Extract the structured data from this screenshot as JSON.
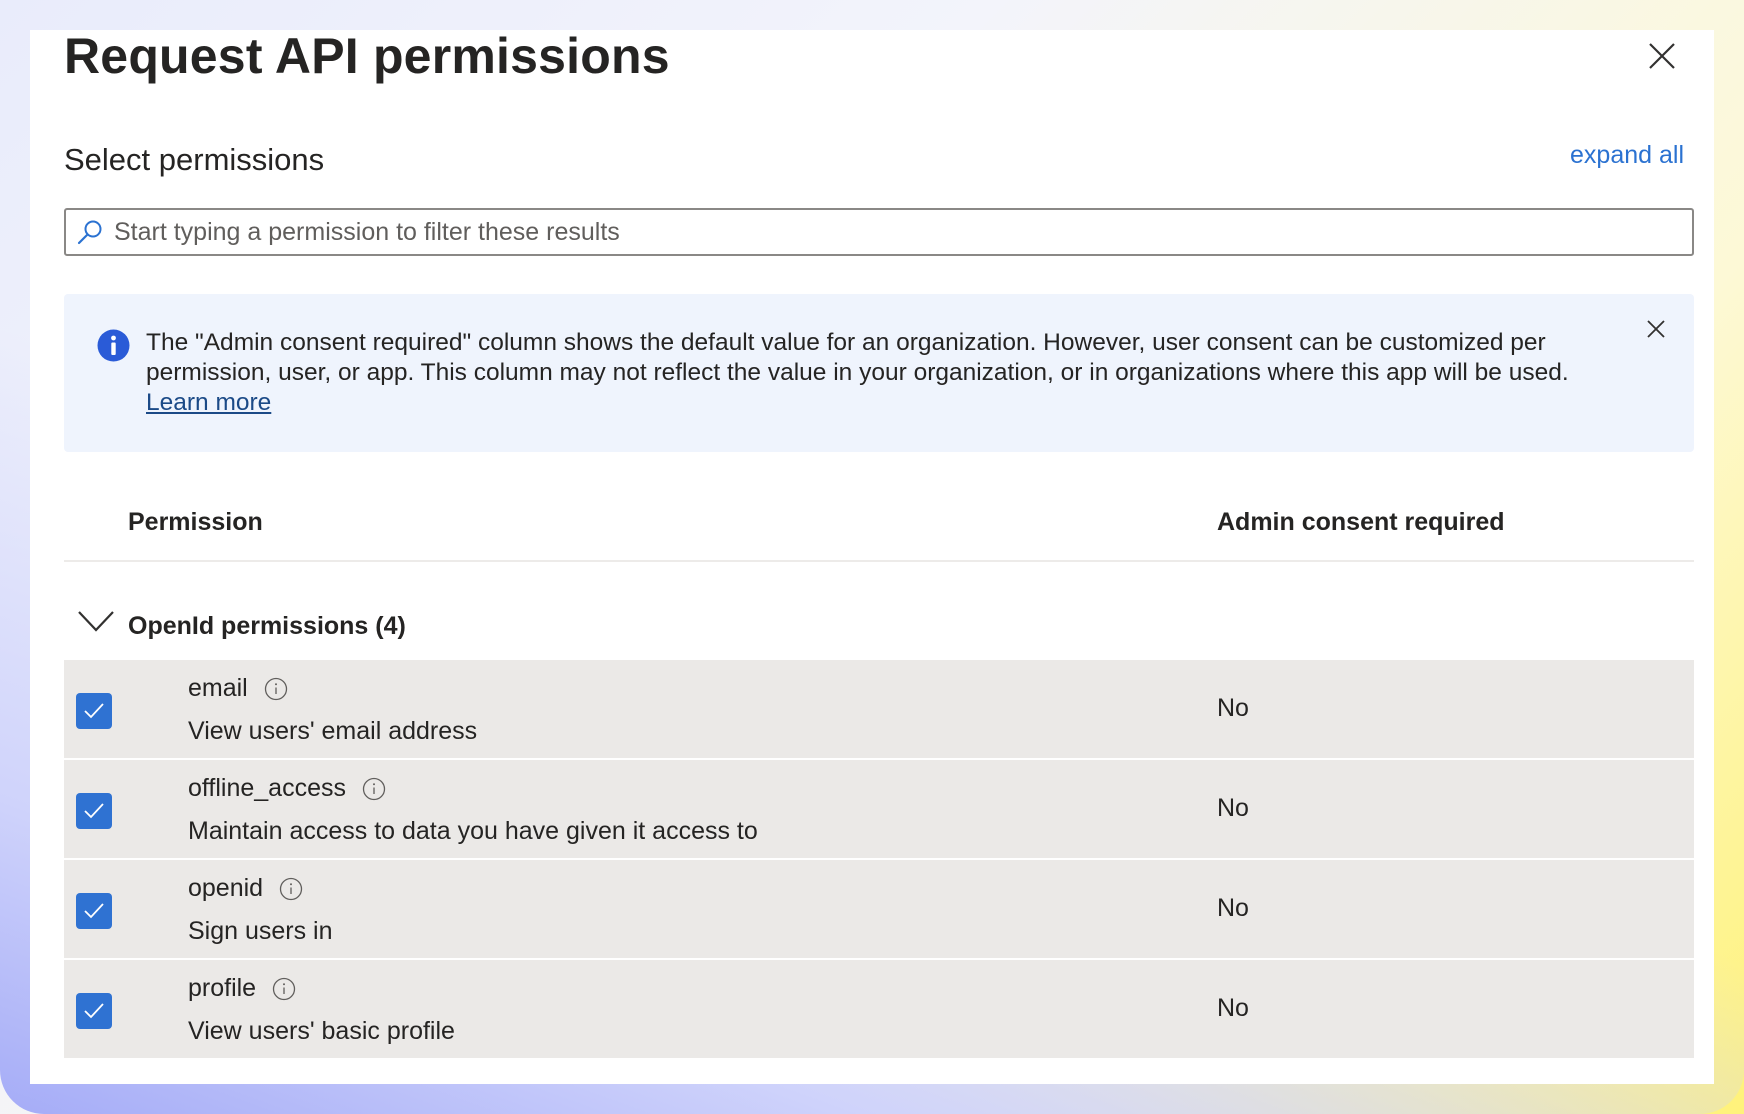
{
  "dialog": {
    "title": "Request API permissions",
    "close_icon": "close-icon"
  },
  "select": {
    "heading": "Select permissions",
    "expand_all": "expand all"
  },
  "search": {
    "placeholder": "Start typing a permission to filter these results",
    "value": "",
    "icon": "search-icon"
  },
  "banner": {
    "icon": "info-icon",
    "text": "The \"Admin consent required\" column shows the default value for an organization. However, user consent can be customized per permission, user, or app. This column may not reflect the value in your organization, or in organizations where this app will be used.",
    "link": "Learn more",
    "dismiss_icon": "close-icon"
  },
  "table": {
    "columns": [
      "Permission",
      "Admin consent required"
    ],
    "group": {
      "label": "OpenId permissions (4)",
      "expanded": true
    },
    "rows": [
      {
        "name": "email",
        "description": "View users' email address",
        "admin_consent": "No",
        "checked": true
      },
      {
        "name": "offline_access",
        "description": "Maintain access to data you have given it access to",
        "admin_consent": "No",
        "checked": true
      },
      {
        "name": "openid",
        "description": "Sign users in",
        "admin_consent": "No",
        "checked": true
      },
      {
        "name": "profile",
        "description": "View users' basic profile",
        "admin_consent": "No",
        "checked": true
      }
    ]
  },
  "colors": {
    "accent": "#2f72d2",
    "link": "#2b72d1",
    "banner_bg": "#eff4fd",
    "row_bg": "#ebe9e7",
    "info_icon": "#2a5bd7"
  }
}
